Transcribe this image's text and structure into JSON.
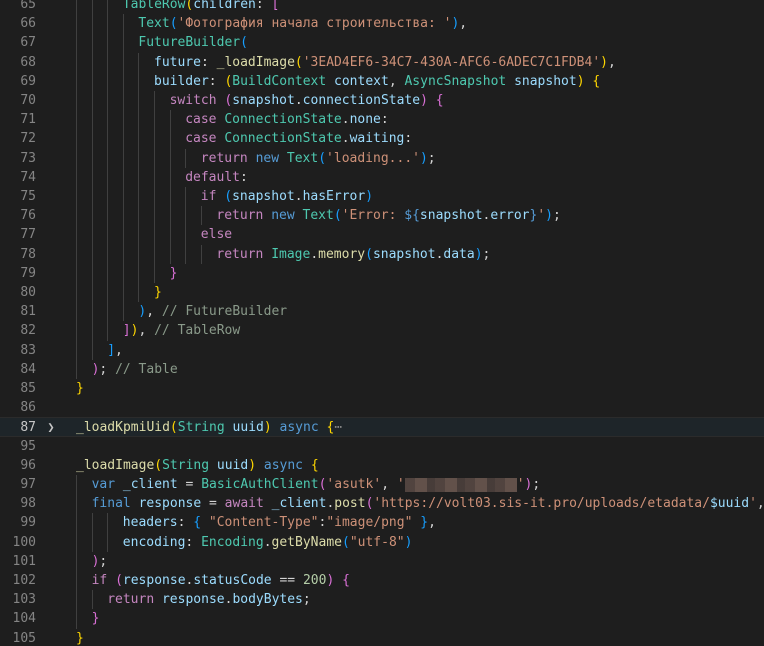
{
  "colors": {
    "background": "#1e1e1e",
    "keyword": "#569cd6",
    "control": "#c586c0",
    "type": "#4ec9b0",
    "function": "#dcdcaa",
    "string": "#ce9178",
    "number": "#b5cea8",
    "variable": "#9cdcfe",
    "plain": "#d4d4d4",
    "comment": "#8a9a8a",
    "line_number": "#858585"
  },
  "fold_icon": "chevron-right-icon",
  "lines": [
    {
      "num": "65",
      "indent": 3,
      "tokens": [
        [
          "ty",
          "TableRow"
        ],
        [
          "b1",
          "("
        ],
        [
          "v",
          "children"
        ],
        [
          "p",
          ": "
        ],
        [
          "b2",
          "["
        ]
      ]
    },
    {
      "num": "66",
      "indent": 4,
      "tokens": [
        [
          "ty",
          "Text"
        ],
        [
          "b3",
          "("
        ],
        [
          "s",
          "'Фотография начала строительства: '"
        ],
        [
          "b3",
          ")"
        ],
        [
          "p",
          ","
        ]
      ]
    },
    {
      "num": "67",
      "indent": 4,
      "tokens": [
        [
          "ty",
          "FutureBuilder"
        ],
        [
          "b3",
          "("
        ]
      ]
    },
    {
      "num": "68",
      "indent": 5,
      "tokens": [
        [
          "v",
          "future"
        ],
        [
          "p",
          ": "
        ],
        [
          "fn",
          "_loadImage"
        ],
        [
          "b1",
          "("
        ],
        [
          "s",
          "'3EAD4EF6-34C7-430A-AFC6-6ADEC7C1FDB4'"
        ],
        [
          "b1",
          ")"
        ],
        [
          "p",
          ","
        ]
      ]
    },
    {
      "num": "69",
      "indent": 5,
      "tokens": [
        [
          "v",
          "builder"
        ],
        [
          "p",
          ": "
        ],
        [
          "b1",
          "("
        ],
        [
          "ty",
          "BuildContext"
        ],
        [
          "p",
          " "
        ],
        [
          "v",
          "context"
        ],
        [
          "p",
          ", "
        ],
        [
          "ty",
          "AsyncSnapshot"
        ],
        [
          "p",
          " "
        ],
        [
          "v",
          "snapshot"
        ],
        [
          "b1",
          ")"
        ],
        [
          "p",
          " "
        ],
        [
          "b1",
          "{"
        ]
      ]
    },
    {
      "num": "70",
      "indent": 6,
      "tokens": [
        [
          "c",
          "switch"
        ],
        [
          "p",
          " "
        ],
        [
          "b2",
          "("
        ],
        [
          "v",
          "snapshot"
        ],
        [
          "p",
          "."
        ],
        [
          "v",
          "connectionState"
        ],
        [
          "b2",
          ")"
        ],
        [
          "p",
          " "
        ],
        [
          "b2",
          "{"
        ]
      ]
    },
    {
      "num": "71",
      "indent": 7,
      "tokens": [
        [
          "c",
          "case"
        ],
        [
          "p",
          " "
        ],
        [
          "ty",
          "ConnectionState"
        ],
        [
          "p",
          "."
        ],
        [
          "v",
          "none"
        ],
        [
          "p",
          ":"
        ]
      ]
    },
    {
      "num": "72",
      "indent": 7,
      "tokens": [
        [
          "c",
          "case"
        ],
        [
          "p",
          " "
        ],
        [
          "ty",
          "ConnectionState"
        ],
        [
          "p",
          "."
        ],
        [
          "v",
          "waiting"
        ],
        [
          "p",
          ":"
        ]
      ]
    },
    {
      "num": "73",
      "indent": 8,
      "tokens": [
        [
          "c",
          "return"
        ],
        [
          "p",
          " "
        ],
        [
          "k",
          "new"
        ],
        [
          "p",
          " "
        ],
        [
          "ty",
          "Text"
        ],
        [
          "b3",
          "("
        ],
        [
          "s",
          "'loading...'"
        ],
        [
          "b3",
          ")"
        ],
        [
          "p",
          ";"
        ]
      ]
    },
    {
      "num": "74",
      "indent": 7,
      "tokens": [
        [
          "c",
          "default"
        ],
        [
          "p",
          ":"
        ]
      ]
    },
    {
      "num": "75",
      "indent": 8,
      "tokens": [
        [
          "c",
          "if"
        ],
        [
          "p",
          " "
        ],
        [
          "b3",
          "("
        ],
        [
          "v",
          "snapshot"
        ],
        [
          "p",
          "."
        ],
        [
          "v",
          "hasError"
        ],
        [
          "b3",
          ")"
        ]
      ]
    },
    {
      "num": "76",
      "indent": 9,
      "tokens": [
        [
          "c",
          "return"
        ],
        [
          "p",
          " "
        ],
        [
          "k",
          "new"
        ],
        [
          "p",
          " "
        ],
        [
          "ty",
          "Text"
        ],
        [
          "b3",
          "("
        ],
        [
          "s",
          "'Error: "
        ],
        [
          "k",
          "${"
        ],
        [
          "v",
          "snapshot"
        ],
        [
          "p",
          "."
        ],
        [
          "v",
          "error"
        ],
        [
          "k",
          "}"
        ],
        [
          "s",
          "'"
        ],
        [
          "b3",
          ")"
        ],
        [
          "p",
          ";"
        ]
      ]
    },
    {
      "num": "77",
      "indent": 8,
      "tokens": [
        [
          "c",
          "else"
        ]
      ]
    },
    {
      "num": "78",
      "indent": 9,
      "tokens": [
        [
          "c",
          "return"
        ],
        [
          "p",
          " "
        ],
        [
          "ty",
          "Image"
        ],
        [
          "p",
          "."
        ],
        [
          "fn",
          "memory"
        ],
        [
          "b3",
          "("
        ],
        [
          "v",
          "snapshot"
        ],
        [
          "p",
          "."
        ],
        [
          "v",
          "data"
        ],
        [
          "b3",
          ")"
        ],
        [
          "p",
          ";"
        ]
      ]
    },
    {
      "num": "79",
      "indent": 6,
      "tokens": [
        [
          "b2",
          "}"
        ]
      ]
    },
    {
      "num": "80",
      "indent": 5,
      "tokens": [
        [
          "b1",
          "}"
        ]
      ]
    },
    {
      "num": "81",
      "indent": 4,
      "tokens": [
        [
          "b3",
          ")"
        ],
        [
          "p",
          ", "
        ],
        [
          "cm",
          "// FutureBuilder"
        ]
      ]
    },
    {
      "num": "82",
      "indent": 3,
      "tokens": [
        [
          "b2",
          "]"
        ],
        [
          "b1",
          ")"
        ],
        [
          "p",
          ", "
        ],
        [
          "cm",
          "// TableRow"
        ]
      ]
    },
    {
      "num": "83",
      "indent": 2,
      "tokens": [
        [
          "b3",
          "]"
        ],
        [
          "p",
          ","
        ]
      ]
    },
    {
      "num": "84",
      "indent": 1,
      "tokens": [
        [
          "b2",
          ")"
        ],
        [
          "p",
          "; "
        ],
        [
          "cm",
          "// Table"
        ]
      ]
    },
    {
      "num": "85",
      "indent": 0,
      "tokens": [
        [
          "b1",
          "}"
        ]
      ]
    },
    {
      "num": "86",
      "indent": 0,
      "tokens": []
    },
    {
      "num": "87",
      "indent": 0,
      "current": true,
      "folded": true,
      "tokens": [
        [
          "fn",
          "_loadKpmiUid"
        ],
        [
          "b1",
          "("
        ],
        [
          "ty",
          "String"
        ],
        [
          "p",
          " "
        ],
        [
          "v",
          "uuid"
        ],
        [
          "b1",
          ")"
        ],
        [
          "p",
          " "
        ],
        [
          "k",
          "async"
        ],
        [
          "p",
          " "
        ],
        [
          "b1",
          "{"
        ],
        [
          "ellipsis",
          "⋯"
        ]
      ]
    },
    {
      "num": "95",
      "indent": 0,
      "tokens": []
    },
    {
      "num": "96",
      "indent": 0,
      "tokens": [
        [
          "fn",
          "_loadImage"
        ],
        [
          "b1",
          "("
        ],
        [
          "ty",
          "String"
        ],
        [
          "p",
          " "
        ],
        [
          "v",
          "uuid"
        ],
        [
          "b1",
          ")"
        ],
        [
          "p",
          " "
        ],
        [
          "k",
          "async"
        ],
        [
          "p",
          " "
        ],
        [
          "b1",
          "{"
        ]
      ]
    },
    {
      "num": "97",
      "indent": 1,
      "tokens": [
        [
          "k",
          "var"
        ],
        [
          "p",
          " "
        ],
        [
          "v",
          "_client"
        ],
        [
          "p",
          " = "
        ],
        [
          "ty",
          "BasicAuthClient"
        ],
        [
          "b2",
          "("
        ],
        [
          "s",
          "'asutk'"
        ],
        [
          "p",
          ", "
        ],
        [
          "s",
          "'"
        ],
        [
          "blur",
          ""
        ],
        [
          "s",
          "'"
        ],
        [
          "b2",
          ")"
        ],
        [
          "p",
          ";"
        ]
      ]
    },
    {
      "num": "98",
      "indent": 1,
      "tokens": [
        [
          "k",
          "final"
        ],
        [
          "p",
          " "
        ],
        [
          "v",
          "response"
        ],
        [
          "p",
          " = "
        ],
        [
          "c",
          "await"
        ],
        [
          "p",
          " "
        ],
        [
          "v",
          "_client"
        ],
        [
          "p",
          "."
        ],
        [
          "fn",
          "post"
        ],
        [
          "b2",
          "("
        ],
        [
          "s",
          "'https://volt03.sis-it.pro/uploads/etadata/"
        ],
        [
          "v",
          "$uuid"
        ],
        [
          "s",
          "'"
        ],
        [
          "p",
          ","
        ]
      ]
    },
    {
      "num": "99",
      "indent": 3,
      "tokens": [
        [
          "v",
          "headers"
        ],
        [
          "p",
          ": "
        ],
        [
          "b3",
          "{"
        ],
        [
          "p",
          " "
        ],
        [
          "s",
          "\"Content-Type\""
        ],
        [
          "p",
          ":"
        ],
        [
          "s",
          "\"image/png\""
        ],
        [
          "p",
          " "
        ],
        [
          "b3",
          "}"
        ],
        [
          "p",
          ","
        ]
      ]
    },
    {
      "num": "100",
      "indent": 3,
      "tokens": [
        [
          "v",
          "encoding"
        ],
        [
          "p",
          ": "
        ],
        [
          "ty",
          "Encoding"
        ],
        [
          "p",
          "."
        ],
        [
          "fn",
          "getByName"
        ],
        [
          "b3",
          "("
        ],
        [
          "s",
          "\"utf-8\""
        ],
        [
          "b3",
          ")"
        ]
      ]
    },
    {
      "num": "101",
      "indent": 1,
      "tokens": [
        [
          "b2",
          ")"
        ],
        [
          "p",
          ";"
        ]
      ]
    },
    {
      "num": "102",
      "indent": 1,
      "tokens": [
        [
          "c",
          "if"
        ],
        [
          "p",
          " "
        ],
        [
          "b2",
          "("
        ],
        [
          "v",
          "response"
        ],
        [
          "p",
          "."
        ],
        [
          "v",
          "statusCode"
        ],
        [
          "p",
          " == "
        ],
        [
          "n",
          "200"
        ],
        [
          "b2",
          ")"
        ],
        [
          "p",
          " "
        ],
        [
          "b2",
          "{"
        ]
      ]
    },
    {
      "num": "103",
      "indent": 2,
      "tokens": [
        [
          "c",
          "return"
        ],
        [
          "p",
          " "
        ],
        [
          "v",
          "response"
        ],
        [
          "p",
          "."
        ],
        [
          "v",
          "bodyBytes"
        ],
        [
          "p",
          ";"
        ]
      ]
    },
    {
      "num": "104",
      "indent": 1,
      "tokens": [
        [
          "b2",
          "}"
        ]
      ]
    },
    {
      "num": "105",
      "indent": 0,
      "tokens": [
        [
          "b1",
          "}"
        ]
      ]
    }
  ]
}
